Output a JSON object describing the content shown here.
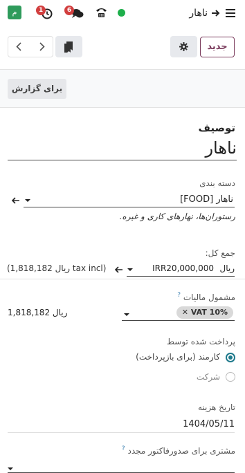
{
  "topbar": {
    "avatar_letter": "م",
    "activity_count": "1",
    "messages_count": "6",
    "breadcrumb": "ناهار"
  },
  "controls": {
    "new_label": "جدید",
    "report_label": "برای گزارش"
  },
  "form": {
    "description_label": "توصیف",
    "description_value": "ناهار",
    "category_label": "دسته بندی",
    "category_value": "[FOOD] ناهار",
    "category_help": "رستوران‌ها، نهارهای کاری و غیره.",
    "total_label": "جمع کل:",
    "total_currency": "ریال",
    "total_value": "IRR20,000,000",
    "tax_incl_text": "(1,818,182 ریال tax incl)",
    "taxes_label": "مشمول مالیات",
    "taxes_help_mark": "?",
    "tax_tag": "VAT 10%",
    "tax_amount": "1,818,182 ریال",
    "paid_by_label": "پرداخت شده توسط",
    "paid_by_options": [
      "کارمند (برای بازپرداخت)",
      "شرکت"
    ],
    "paid_by_selected": 0,
    "date_label": "تاریخ هزینه",
    "date_value": "1404/05/11",
    "reinvoice_label": "مشتری برای صدورفاکتور مجدد",
    "reinvoice_help_mark": "?"
  },
  "colors": {
    "brand": "#7a3b5c",
    "online": "#1eaf4b",
    "badge": "#d23f3f",
    "radio": "#1f7a8c"
  }
}
